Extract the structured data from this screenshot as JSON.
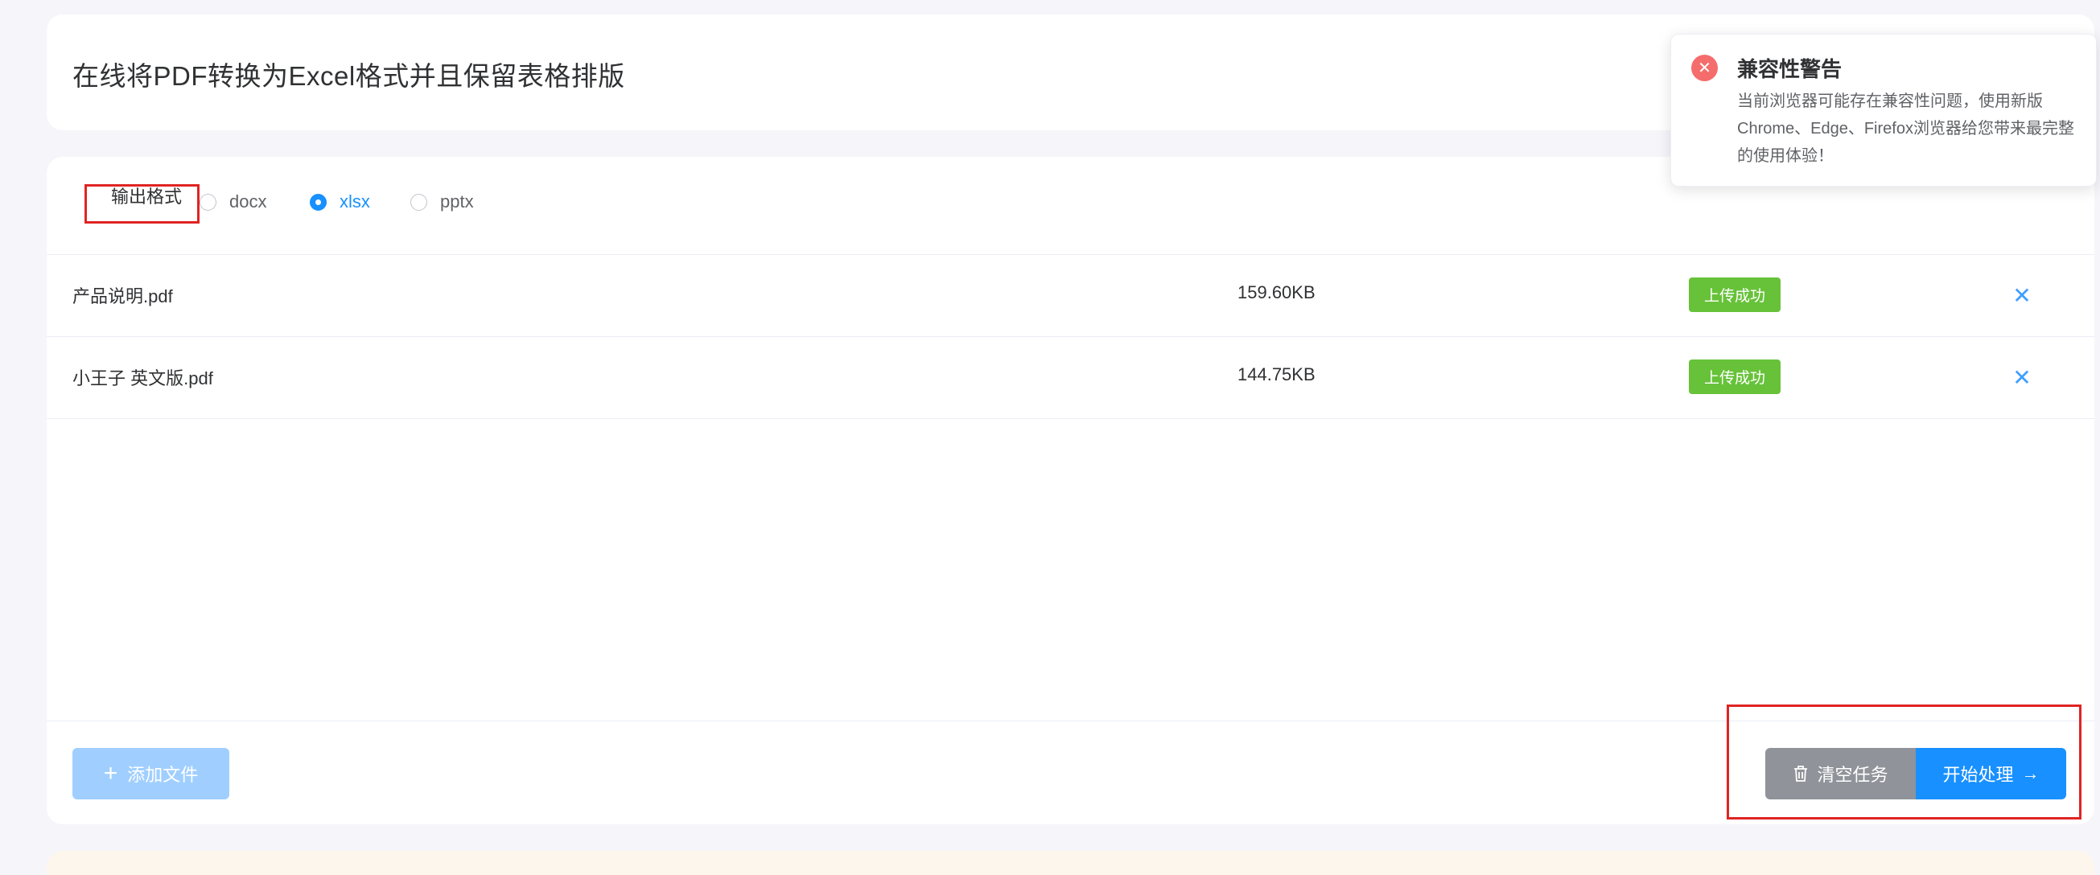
{
  "page": {
    "title": "在线将PDF转换为Excel格式并且保留表格排版"
  },
  "format": {
    "label": "输出格式",
    "options": [
      {
        "label": "docx",
        "checked": false
      },
      {
        "label": "xlsx",
        "checked": true
      },
      {
        "label": "pptx",
        "checked": false
      }
    ]
  },
  "files": [
    {
      "name": "产品说明.pdf",
      "size": "159.60KB",
      "status": "上传成功"
    },
    {
      "name": "小王子 英文版.pdf",
      "size": "144.75KB",
      "status": "上传成功"
    }
  ],
  "actions": {
    "add": "添加文件",
    "clear": "清空任务",
    "start": "开始处理"
  },
  "notice": {
    "title": "兼容性警告",
    "body": "当前浏览器可能存在兼容性问题，使用新版Chrome、Edge、Firefox浏览器给您带来最完整的使用体验！"
  },
  "colors": {
    "primary": "#1890ff",
    "success": "#67c23a",
    "danger": "#f56c6c",
    "highlight": "#e02424"
  }
}
